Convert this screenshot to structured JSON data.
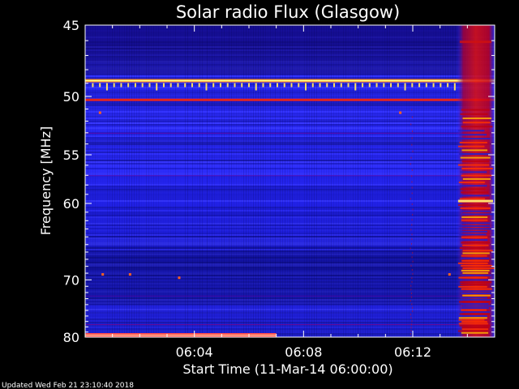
{
  "chart_data": {
    "type": "heatmap",
    "title": "Solar radio Flux (Glasgow)",
    "xlabel": "Start Time (11-Mar-14 06:00:00)",
    "ylabel": "Frequency [MHz]",
    "x_ticks": [
      "06:04",
      "06:08",
      "06:12"
    ],
    "x_tick_minutes": [
      4,
      8,
      12
    ],
    "x_range_minutes": [
      0,
      15
    ],
    "y_ticks": [
      45,
      50,
      55,
      60,
      70,
      80
    ],
    "y_range_mhz": [
      45,
      80
    ],
    "y_scale": "reciprocal (inverted, 45 MHz at top)",
    "colormap": [
      "#08004a",
      "#1a10c8",
      "#2a2aff",
      "#9000d0",
      "#d01010",
      "#ff5000",
      "#ffd000",
      "#ffff80"
    ],
    "background_level": "blue",
    "persistent_lines_mhz": [
      48.8,
      50.3
    ],
    "burst": {
      "start_minute": 13.6,
      "end_minute": 15,
      "level": "high (red/yellow)"
    },
    "low_band_line": {
      "frequency_mhz": 80,
      "start_minute": 0,
      "end_minute": 7,
      "level": "high"
    },
    "footer": "Updated Wed Feb 21 23:10:40 2018"
  }
}
